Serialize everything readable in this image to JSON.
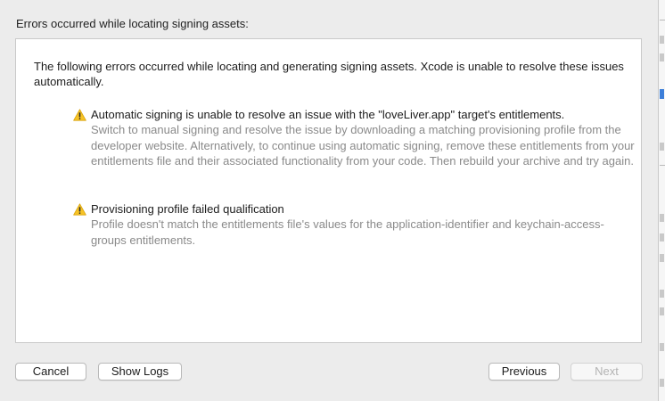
{
  "dialog": {
    "header": "Errors occurred while locating signing assets:",
    "intro": "The following errors occurred while locating and generating signing assets. Xcode is unable to resolve these issues automatically.",
    "issues": [
      {
        "icon": "warning-icon",
        "title": "Automatic signing is unable to resolve an issue with the \"loveLiver.app\" target's entitlements.",
        "body": "Switch to manual signing and resolve the issue by downloading a matching provisioning profile from the developer website. Alternatively, to continue using automatic signing, remove these entitlements from your entitlements file and their associated functionality from your code. Then rebuild your archive and try again."
      },
      {
        "icon": "warning-icon",
        "title": "Provisioning profile failed qualification",
        "body": "Profile doesn't match the entitlements file's values for the application-identifier and keychain-access-groups entitlements."
      }
    ]
  },
  "buttons": {
    "cancel": "Cancel",
    "show_logs": "Show Logs",
    "previous": "Previous",
    "next": "Next"
  },
  "colors": {
    "warning": "#f7c325",
    "secondary_text": "#8a8a8a",
    "disabled_text": "#b3b3b3"
  }
}
